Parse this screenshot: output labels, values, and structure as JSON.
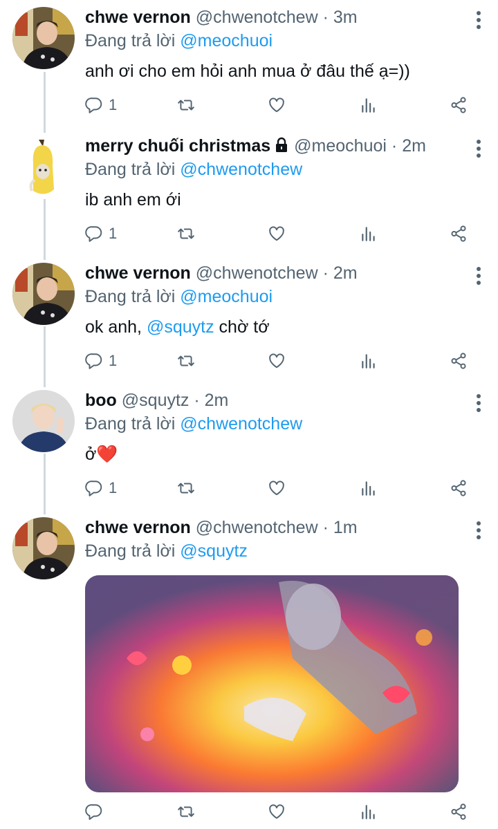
{
  "tweets": [
    {
      "name": "chwe vernon",
      "handle": "@chwenotchew",
      "sep": "·",
      "time": "3m",
      "reply_prefix": "Đang trả lời",
      "reply_to": "@meochuoi",
      "text": "anh ơi cho em hỏi anh mua ở đâu thế ạ=))",
      "reply_count": "1"
    },
    {
      "name": "merry chuối christmas",
      "handle": "@meochuoi",
      "sep": "·",
      "time": "2m",
      "reply_prefix": "Đang trả lời",
      "reply_to": "@chwenotchew",
      "text": "ib anh em ới",
      "reply_count": "1"
    },
    {
      "name": "chwe vernon",
      "handle": "@chwenotchew",
      "sep": "·",
      "time": "2m",
      "reply_prefix": "Đang trả lời",
      "reply_to": "@meochuoi",
      "text_before": "ok anh, ",
      "text_mention": "@squytz",
      "text_after": " chờ tớ",
      "reply_count": "1"
    },
    {
      "name": "boo",
      "handle": "@squytz",
      "sep": "·",
      "time": "2m",
      "reply_prefix": "Đang trả lời",
      "reply_to": "@chwenotchew",
      "text": "ở❤️",
      "reply_count": "1"
    },
    {
      "name": "chwe vernon",
      "handle": "@chwenotchew",
      "sep": "·",
      "time": "1m",
      "reply_prefix": "Đang trả lời",
      "reply_to": "@squytz",
      "reply_count": ""
    }
  ],
  "icons": {
    "reply": "reply-icon",
    "retweet": "retweet-icon",
    "like": "heart-icon",
    "stats": "stats-icon",
    "share": "share-icon",
    "more": "more-vertical-icon",
    "lock": "lock-icon"
  },
  "colors": {
    "mention": "#1d9bf0",
    "secondary_text": "#536471",
    "primary_text": "#0f1419",
    "thread_line": "#cfd9de"
  }
}
